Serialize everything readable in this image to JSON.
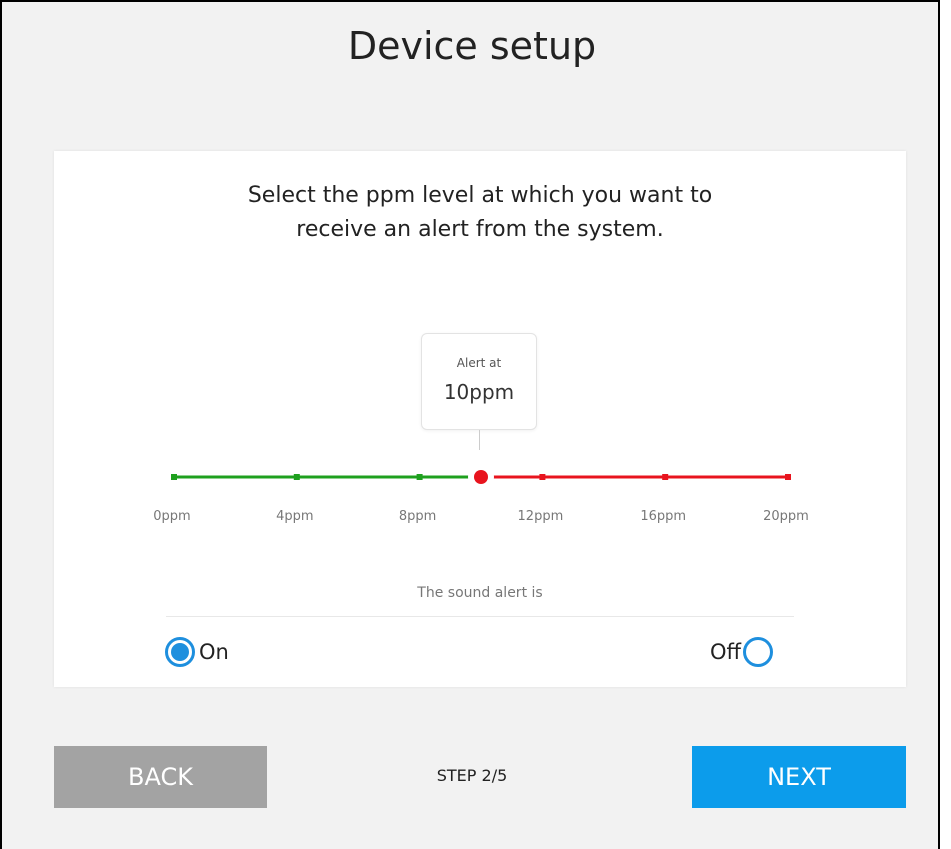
{
  "page": {
    "title": "Device setup"
  },
  "card": {
    "question_line1": "Select the ppm level at which you want to",
    "question_line2": "receive an alert from the system."
  },
  "alert_slider": {
    "bubble_label": "Alert at",
    "bubble_value": "10ppm",
    "value_ppm": 10,
    "min_ppm": 0,
    "max_ppm": 20,
    "tick_values_ppm": [
      0,
      4,
      8,
      12,
      16,
      20
    ],
    "tick_labels": [
      "0ppm",
      "4ppm",
      "8ppm",
      "12ppm",
      "16ppm",
      "20ppm"
    ],
    "below_color": "#1ea01e",
    "above_color": "#e8141e"
  },
  "sound": {
    "caption": "The sound alert is",
    "on_label": "On",
    "off_label": "Off",
    "selected": "On",
    "accent_color": "#1e8fde"
  },
  "footer": {
    "back_label": "BACK",
    "step_text": "STEP 2/5",
    "next_label": "NEXT"
  }
}
